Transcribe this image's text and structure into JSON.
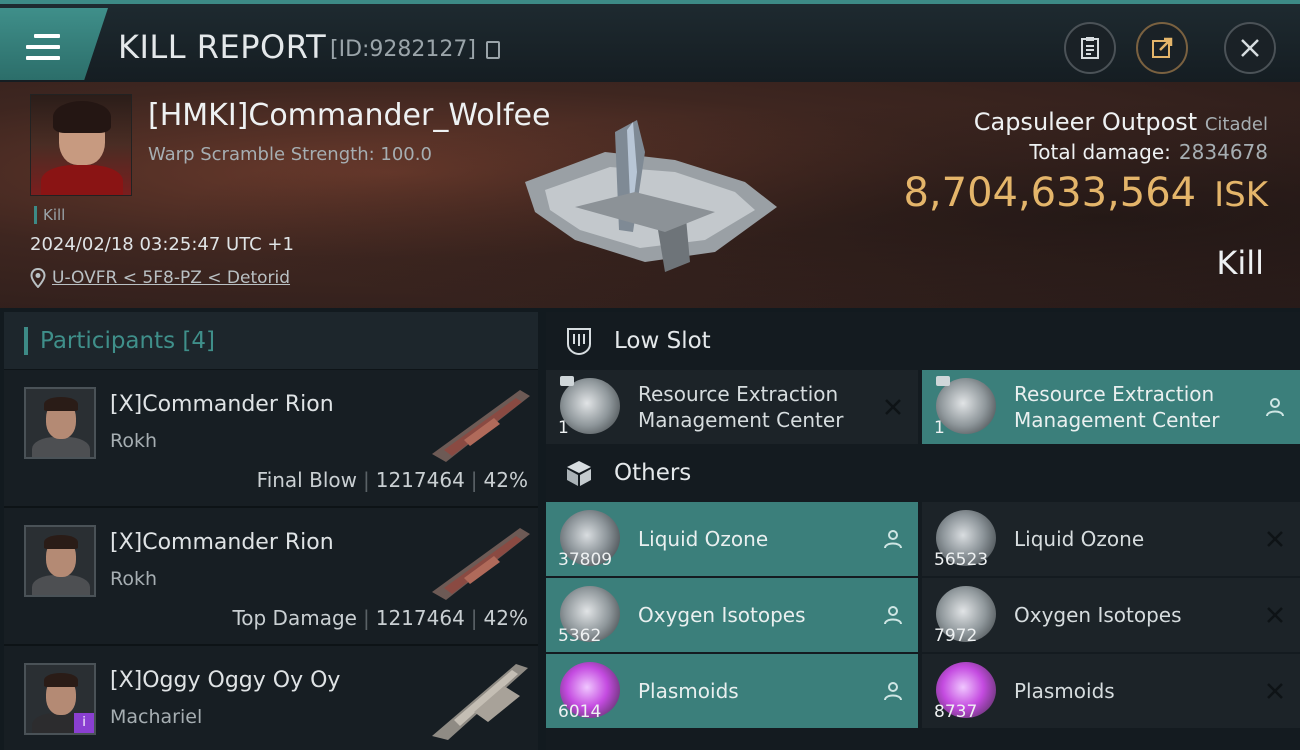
{
  "header": {
    "title": "KILL REPORT",
    "report_id": "[ID:9282127]",
    "icons": [
      "menu-icon",
      "copy-icon",
      "clipboard-icon",
      "share-icon",
      "close-icon"
    ]
  },
  "victim": {
    "name": "[HMKI]Commander_Wolfee",
    "warp_scramble": "Warp Scramble Strength: 100.0",
    "tag": "Kill",
    "time": "2024/02/18 03:25:47 UTC +1",
    "location": "U-OVFR < 5F8-PZ < Detorid"
  },
  "target": {
    "name": "Capsuleer Outpost",
    "class": "Citadel",
    "total_damage_label": "Total damage:",
    "total_damage": "2834678",
    "isk_value": "8,704,633,564",
    "isk_unit": "ISK",
    "kill_type": "Kill"
  },
  "participants": {
    "label": "Participants [4]",
    "rows": [
      {
        "name": "[X]Commander Rion",
        "ship": "Rokh",
        "role": "Final Blow",
        "damage": "1217464",
        "pct": "42%"
      },
      {
        "name": "[X]Commander Rion",
        "ship": "Rokh",
        "role": "Top Damage",
        "damage": "1217464",
        "pct": "42%"
      },
      {
        "name": "[X]Oggy Oggy Oy Oy",
        "ship": "Machariel",
        "role": "",
        "damage": "",
        "pct": ""
      }
    ]
  },
  "low_slot": {
    "label": "Low Slot",
    "items": [
      {
        "qty": "1",
        "name": "Resource Extraction Management Center",
        "status": "destroyed"
      },
      {
        "qty": "1",
        "name": "Resource Extraction Management Center",
        "status": "dropped"
      }
    ]
  },
  "others": {
    "label": "Others",
    "items": [
      {
        "qty": "37809",
        "name": "Liquid Ozone",
        "status": "dropped"
      },
      {
        "qty": "56523",
        "name": "Liquid Ozone",
        "status": "destroyed"
      },
      {
        "qty": "5362",
        "name": "Oxygen Isotopes",
        "status": "dropped"
      },
      {
        "qty": "7972",
        "name": "Oxygen Isotopes",
        "status": "destroyed"
      },
      {
        "qty": "6014",
        "name": "Plasmoids",
        "status": "dropped"
      },
      {
        "qty": "8737",
        "name": "Plasmoids",
        "status": "destroyed"
      }
    ]
  },
  "colors": {
    "accent": "#3d8a86",
    "isk": "#e4b56a",
    "dropped_bg": "#3b7f7b"
  }
}
